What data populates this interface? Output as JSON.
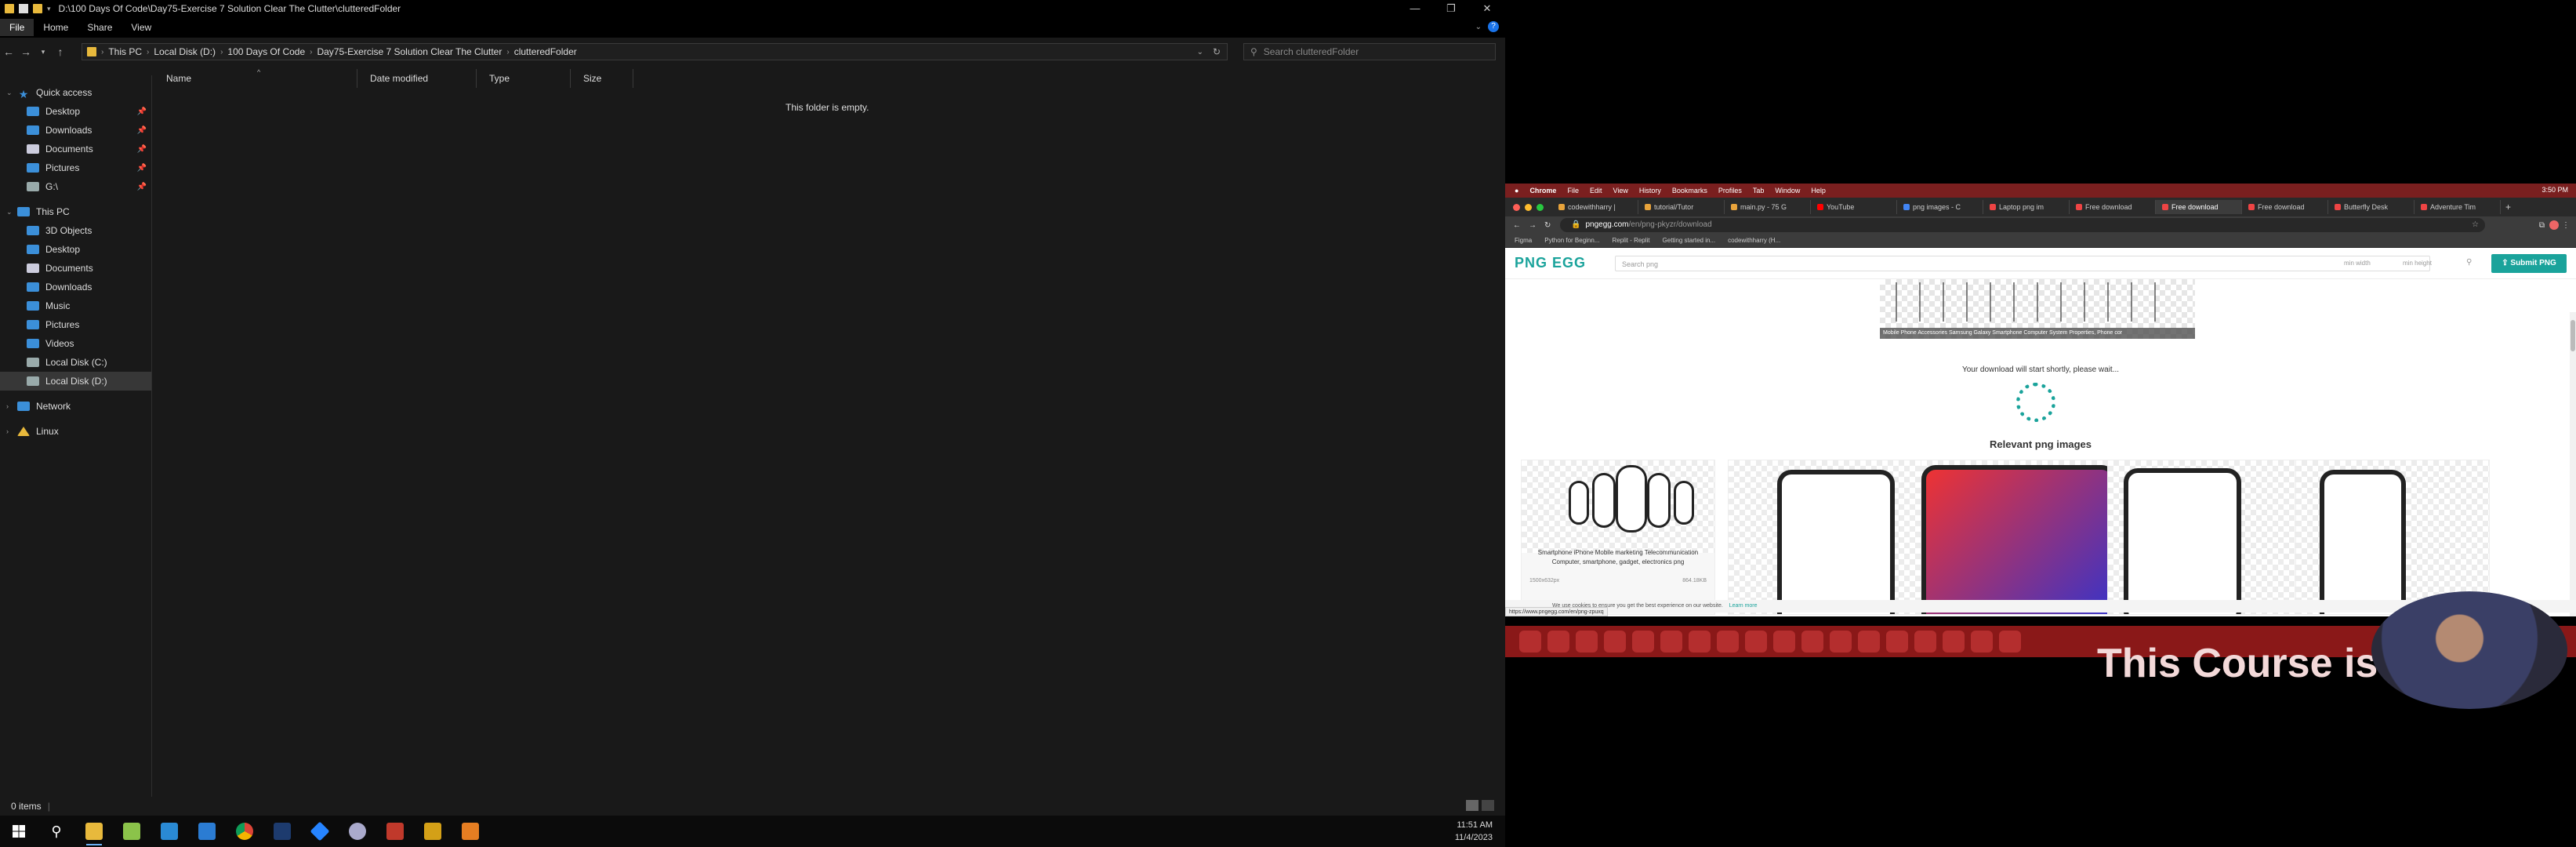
{
  "explorer": {
    "title": "D:\\100 Days Of Code\\Day75-Exercise 7 Solution Clear The Clutter\\clutteredFolder",
    "ribbon_tabs": [
      "File",
      "Home",
      "Share",
      "View"
    ],
    "breadcrumbs": [
      "This PC",
      "Local Disk (D:)",
      "100 Days Of Code",
      "Day75-Exercise 7 Solution Clear The Clutter",
      "clutteredFolder"
    ],
    "search_placeholder": "Search clutteredFolder",
    "columns": [
      "Name",
      "Date modified",
      "Type",
      "Size"
    ],
    "empty_message": "This folder is empty.",
    "status": "0 items",
    "nav": {
      "quick_access": "Quick access",
      "quick_items": [
        "Desktop",
        "Downloads",
        "Documents",
        "Pictures",
        "G:\\"
      ],
      "this_pc": "This PC",
      "pc_items": [
        "3D Objects",
        "Desktop",
        "Documents",
        "Downloads",
        "Music",
        "Pictures",
        "Videos",
        "Local Disk (C:)",
        "Local Disk (D:)"
      ],
      "network": "Network",
      "linux": "Linux"
    }
  },
  "taskbar": {
    "time": "11:51 AM",
    "date": "11/4/2023"
  },
  "mac": {
    "menubar": [
      "Chrome",
      "File",
      "Edit",
      "View",
      "History",
      "Bookmarks",
      "Profiles",
      "Tab",
      "Window",
      "Help"
    ],
    "clock": "3:50 PM",
    "tabs": [
      "codewithharry |",
      "tutorial/Tutor",
      "main.py - 75 G",
      "YouTube",
      "png images - C",
      "Laptop png im",
      "Free download",
      "Free download",
      "Free download",
      "Butterfly Desk",
      "Adventure Tim"
    ],
    "url_host": "pngegg.com",
    "url_path": "/en/png-pkyzr/download",
    "bookmarks": [
      "Figma",
      "Python for Beginn...",
      "Replit - Replit",
      "Getting started in...",
      "codewithharry (H..."
    ]
  },
  "site": {
    "logo": "PNG EGG",
    "search_placeholder": "Search png",
    "min_width": "min width",
    "min_height": "min height",
    "submit": "Submit PNG",
    "banner_caption": "Mobile Phone Accessories Samsung Galaxy Smartphone Computer System Properties, Phone cor",
    "wait_message": "Your download will start shortly, please wait...",
    "relevant_title": "Relevant png images",
    "card_caption": "Smartphone iPhone Mobile marketing Telecommunication Computer, smartphone, gadget, electronics png",
    "card_dims": "1500x632px",
    "card_size": "864.18KB",
    "cookie_text": "We use cookies to ensure you get the best experience on our website.",
    "cookie_link": "Learn more",
    "status_url": "https://www.pngegg.com/en/png-zpuxq"
  },
  "overlay": {
    "course_text": "This Course is Availabl"
  }
}
